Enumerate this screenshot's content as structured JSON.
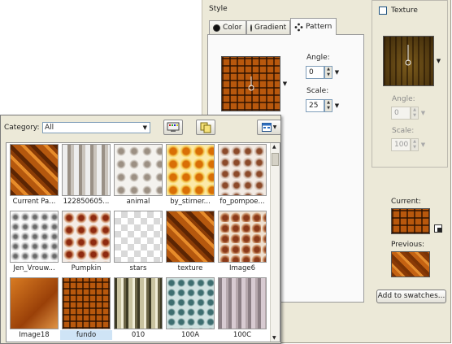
{
  "style_dialog": {
    "section_label": "Style",
    "tabs": [
      {
        "label": "Color"
      },
      {
        "label": "Gradient"
      },
      {
        "label": "Pattern",
        "active": true
      }
    ],
    "pattern": {
      "angle_label": "Angle:",
      "angle_value": "0",
      "scale_label": "Scale:",
      "scale_value": "25"
    },
    "texture": {
      "label": "Texture",
      "checked": false,
      "angle_label": "Angle:",
      "angle_value": "0",
      "scale_label": "Scale:",
      "scale_value": "100"
    },
    "current_label": "Current:",
    "previous_label": "Previous:",
    "add_button": "Add to swatches..."
  },
  "picker": {
    "category_label": "Category:",
    "category_value": "All",
    "items": [
      {
        "caption": "Current Pa...",
        "pattern": "t-wood"
      },
      {
        "caption": "122850605...",
        "pattern": "t-cats"
      },
      {
        "caption": "animal",
        "pattern": "t-animal"
      },
      {
        "caption": "by_stirner...",
        "pattern": "t-fish"
      },
      {
        "caption": "fo_pompoe...",
        "pattern": "t-fo"
      },
      {
        "caption": "Jen_Vrouw...",
        "pattern": "t-jen"
      },
      {
        "caption": "Pumpkin",
        "pattern": "t-pumpkin"
      },
      {
        "caption": "stars",
        "pattern": "t-stars"
      },
      {
        "caption": "texture",
        "pattern": "t-wood"
      },
      {
        "caption": "Image6",
        "pattern": "t-image6"
      },
      {
        "caption": "Image18",
        "pattern": "t-image18"
      },
      {
        "caption": "fundo",
        "pattern": "t-fundo",
        "selected": true
      },
      {
        "caption": "010",
        "pattern": "t-010"
      },
      {
        "caption": "100A",
        "pattern": "t-100a"
      },
      {
        "caption": "100C",
        "pattern": "t-100c"
      }
    ]
  },
  "colors": {
    "dialog_bg": "#ece9d8",
    "selection": "#cfe4f6",
    "input_border": "#7f9db9"
  }
}
